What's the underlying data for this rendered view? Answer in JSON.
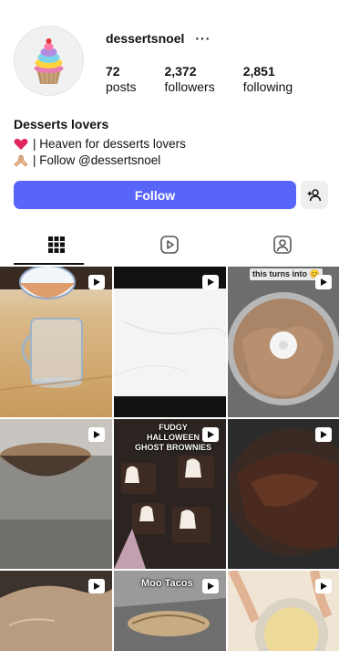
{
  "profile": {
    "username": "dessertsnoel",
    "more": "···",
    "stats": [
      {
        "num": "72",
        "label": "posts"
      },
      {
        "num": "2,372",
        "label": "followers"
      },
      {
        "num": "2,851",
        "label": "following"
      }
    ],
    "bio_name": "Desserts lovers",
    "bio_line1": "| Heaven for desserts lovers",
    "bio_line2": "| Follow @dessertsnoel",
    "follow_label": "Follow"
  },
  "tabs": [
    "grid-icon",
    "reels-icon",
    "tagged-icon"
  ],
  "grid": {
    "tiles": [
      {
        "caption": "",
        "kind": "glass"
      },
      {
        "caption": "",
        "kind": "marble"
      },
      {
        "caption": "this turns into 😊",
        "kind": "mixer"
      },
      {
        "caption": "",
        "kind": "bowl"
      },
      {
        "caption": "FUDGY HALLOWEEN GHOST BROWNIES",
        "kind": "brownies"
      },
      {
        "caption": "",
        "kind": "chocolate"
      },
      {
        "caption": "",
        "kind": "dough"
      },
      {
        "caption": "Moo Tacos",
        "kind": "tacos"
      },
      {
        "caption": "",
        "kind": "cream"
      }
    ]
  },
  "colors": {
    "follow": "#5865f9",
    "heart": "#e0245e"
  }
}
